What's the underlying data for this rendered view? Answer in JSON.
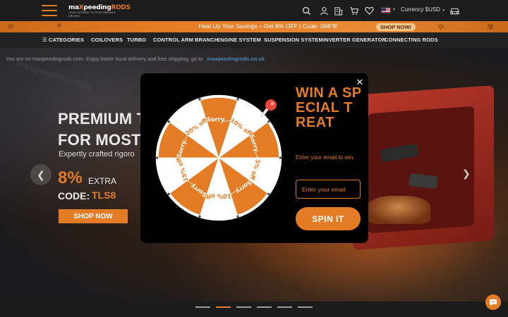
{
  "header": {
    "logo_main": "maxpeedingrods",
    "logo_tag": "YOUR GATEWAY TO PERFORMANCE DRIVING",
    "logo_official": "OFFICIAL SITE",
    "currency_label": "Currency $USD",
    "icons": [
      "search-icon",
      "account-icon",
      "store-icon",
      "cart-icon",
      "wishlist-icon",
      "us-flag-icon",
      "car-icon"
    ]
  },
  "promo": {
    "text": "Heat Up Your Savings – Get 8% OFF | Code: SMF8!",
    "button": "SHOP NOW!"
  },
  "nav": {
    "categories": "CATEGORIES",
    "items": [
      "COILOVERS",
      "TURBO",
      "CONTROL ARM BRANCH",
      "ENGINE SYSTEM",
      "SUSPENSION SYSTEM",
      "INVERTER GENERATOR",
      "CONNECTING RODS"
    ]
  },
  "hero": {
    "info_text": "You are on maxpeedingrods.com. Enjoy faster local delivery and free shipping, go to",
    "info_link": "maxpeedingrods.co.uk",
    "headline_1": "PREMIUM TO",
    "headline_2": "FOR MOST R",
    "subtitle": "Expertly crafted rigoro",
    "percent": "8%",
    "extra": "EXTRA",
    "code_label": "CODE:",
    "code": "TLS8",
    "shop_button": "SHOP NOW"
  },
  "slider": {
    "count": 6,
    "active_index": 1
  },
  "popup": {
    "title": "WIN A SPECIAL TREAT",
    "description": "Enter your email to win.",
    "email_placeholder": "Enter your email",
    "spin_button": "SPIN IT",
    "wheel_segments": [
      "10% off",
      "Sorry...",
      "5% off",
      "Sorry...",
      "10% off",
      "Sorry...",
      "15% off",
      "Sorry...",
      "20% off",
      "Sorry..."
    ],
    "colors": {
      "accent": "#e47b25",
      "light": "#ffffff",
      "background": "#000000"
    }
  }
}
